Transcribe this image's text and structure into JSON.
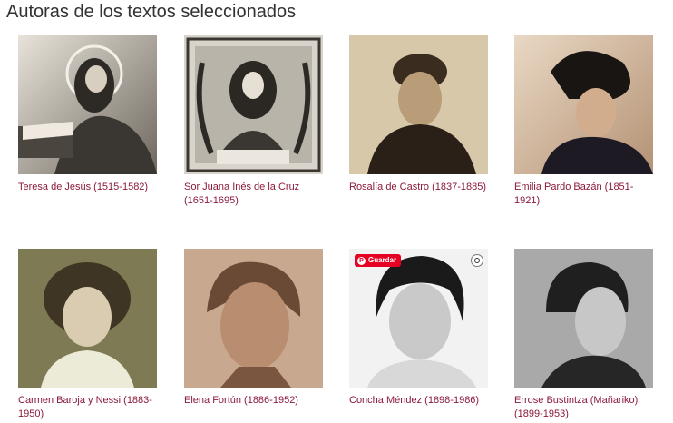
{
  "page": {
    "title": "Autoras de los textos seleccionados"
  },
  "authors": [
    {
      "caption": "Teresa de Jesús (1515-1582)"
    },
    {
      "caption": "Sor Juana Inés de la Cruz (1651-1695)"
    },
    {
      "caption": "Rosalía de Castro (1837-1885)"
    },
    {
      "caption": "Emilia Pardo Bazán (1851-1921)"
    },
    {
      "caption": "Carmen Baroja y Nessi (1883-1950)"
    },
    {
      "caption": "Elena Fortún (1886-1952)"
    },
    {
      "caption": "Concha Méndez (1898-1986)"
    },
    {
      "caption": "Errose Bustintza (Mañariko) (1899-1953)"
    }
  ],
  "overlay": {
    "save_label": "Guardar",
    "pin_glyph": "P"
  },
  "colors": {
    "caption": "#8b1a3a",
    "title": "#333333",
    "pinterest": "#e60023"
  }
}
